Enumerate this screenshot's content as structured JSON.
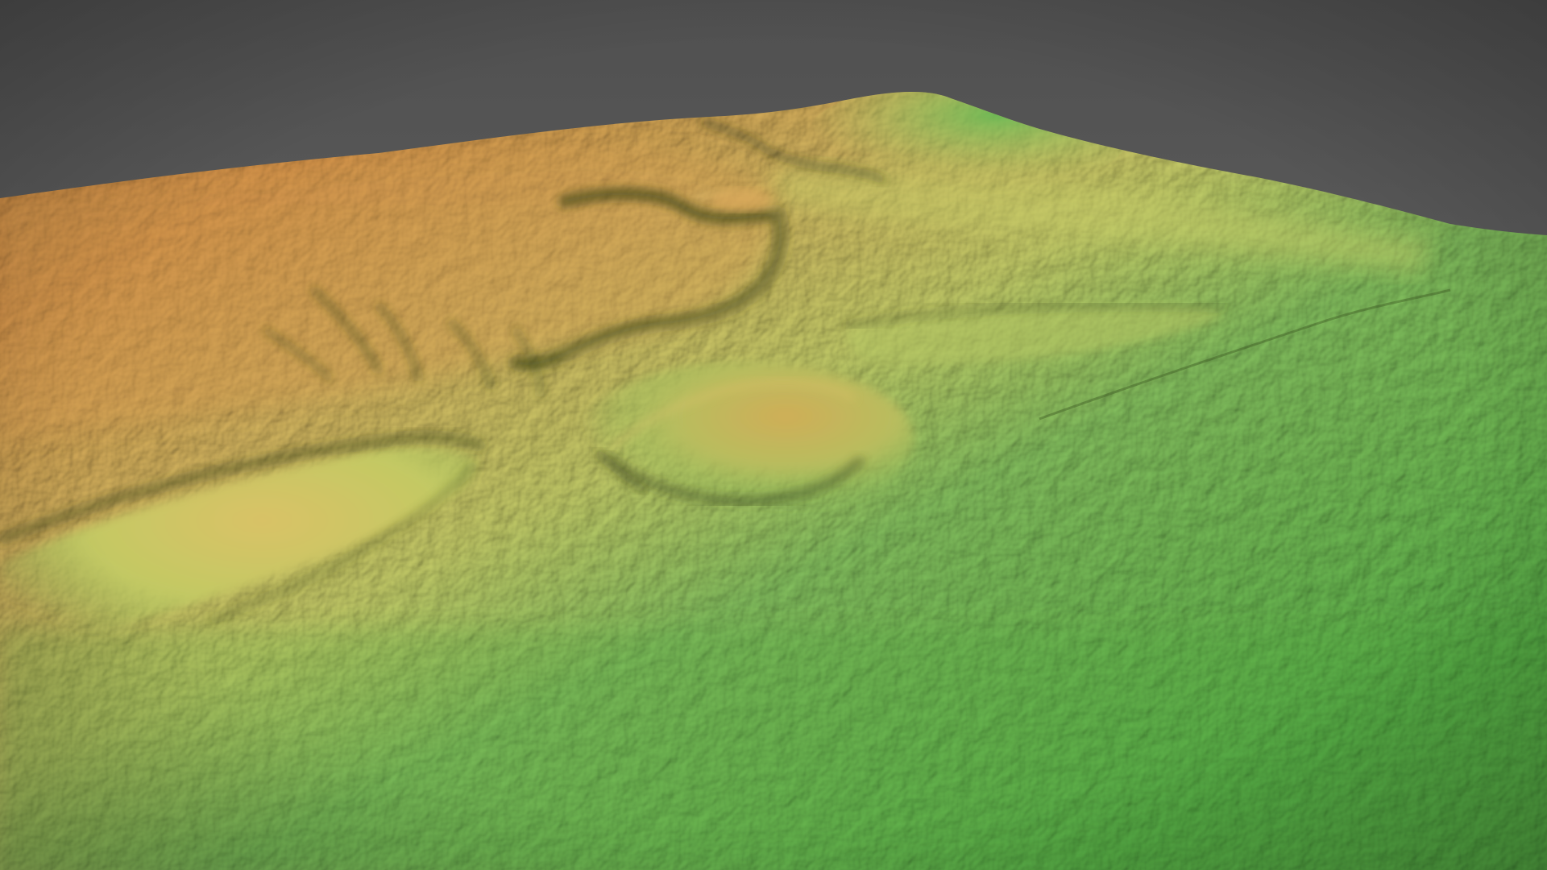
{
  "scene": {
    "colors": {
      "background_top": "#505050",
      "background_bottom": "#6e6e6e",
      "terrain_high": "#d9954a",
      "terrain_mid_high": "#d6b660",
      "terrain_mid": "#c7cf6a",
      "terrain_low": "#86c260",
      "terrain_lowest": "#5cb54a",
      "shadow": "#2e3a18"
    },
    "features": [
      "ridge-escarpment",
      "central-mound",
      "left-spur",
      "gully-channel",
      "far-hill"
    ]
  }
}
